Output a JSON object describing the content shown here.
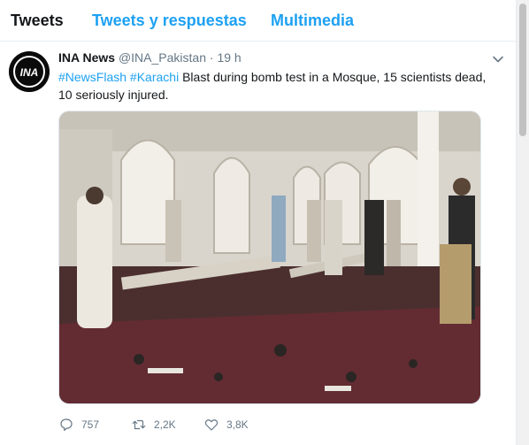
{
  "tabs": [
    "Tweets",
    "Tweets y respuestas",
    "Multimedia"
  ],
  "tweet": {
    "name": "INA News",
    "handle": "@INA_Pakistan",
    "separator": "·",
    "time": "19 h",
    "avatar_text": "INA",
    "hashtags": [
      "#NewsFlash",
      "#Karachi"
    ],
    "text": "Blast during bomb test in a Mosque, 15 scientists dead, 10 seriously injured.",
    "media_alt": "Damaged mosque interior with debris and men standing",
    "stats": {
      "replies": "757",
      "retweets": "2,2K",
      "likes": "3,8K"
    }
  },
  "icons": {
    "reply": "reply-icon",
    "retweet": "retweet-icon",
    "like": "heart-icon",
    "more": "chevron-down-icon"
  },
  "colors": {
    "accent": "#1da1f2",
    "text": "#14171a",
    "muted": "#657786"
  }
}
